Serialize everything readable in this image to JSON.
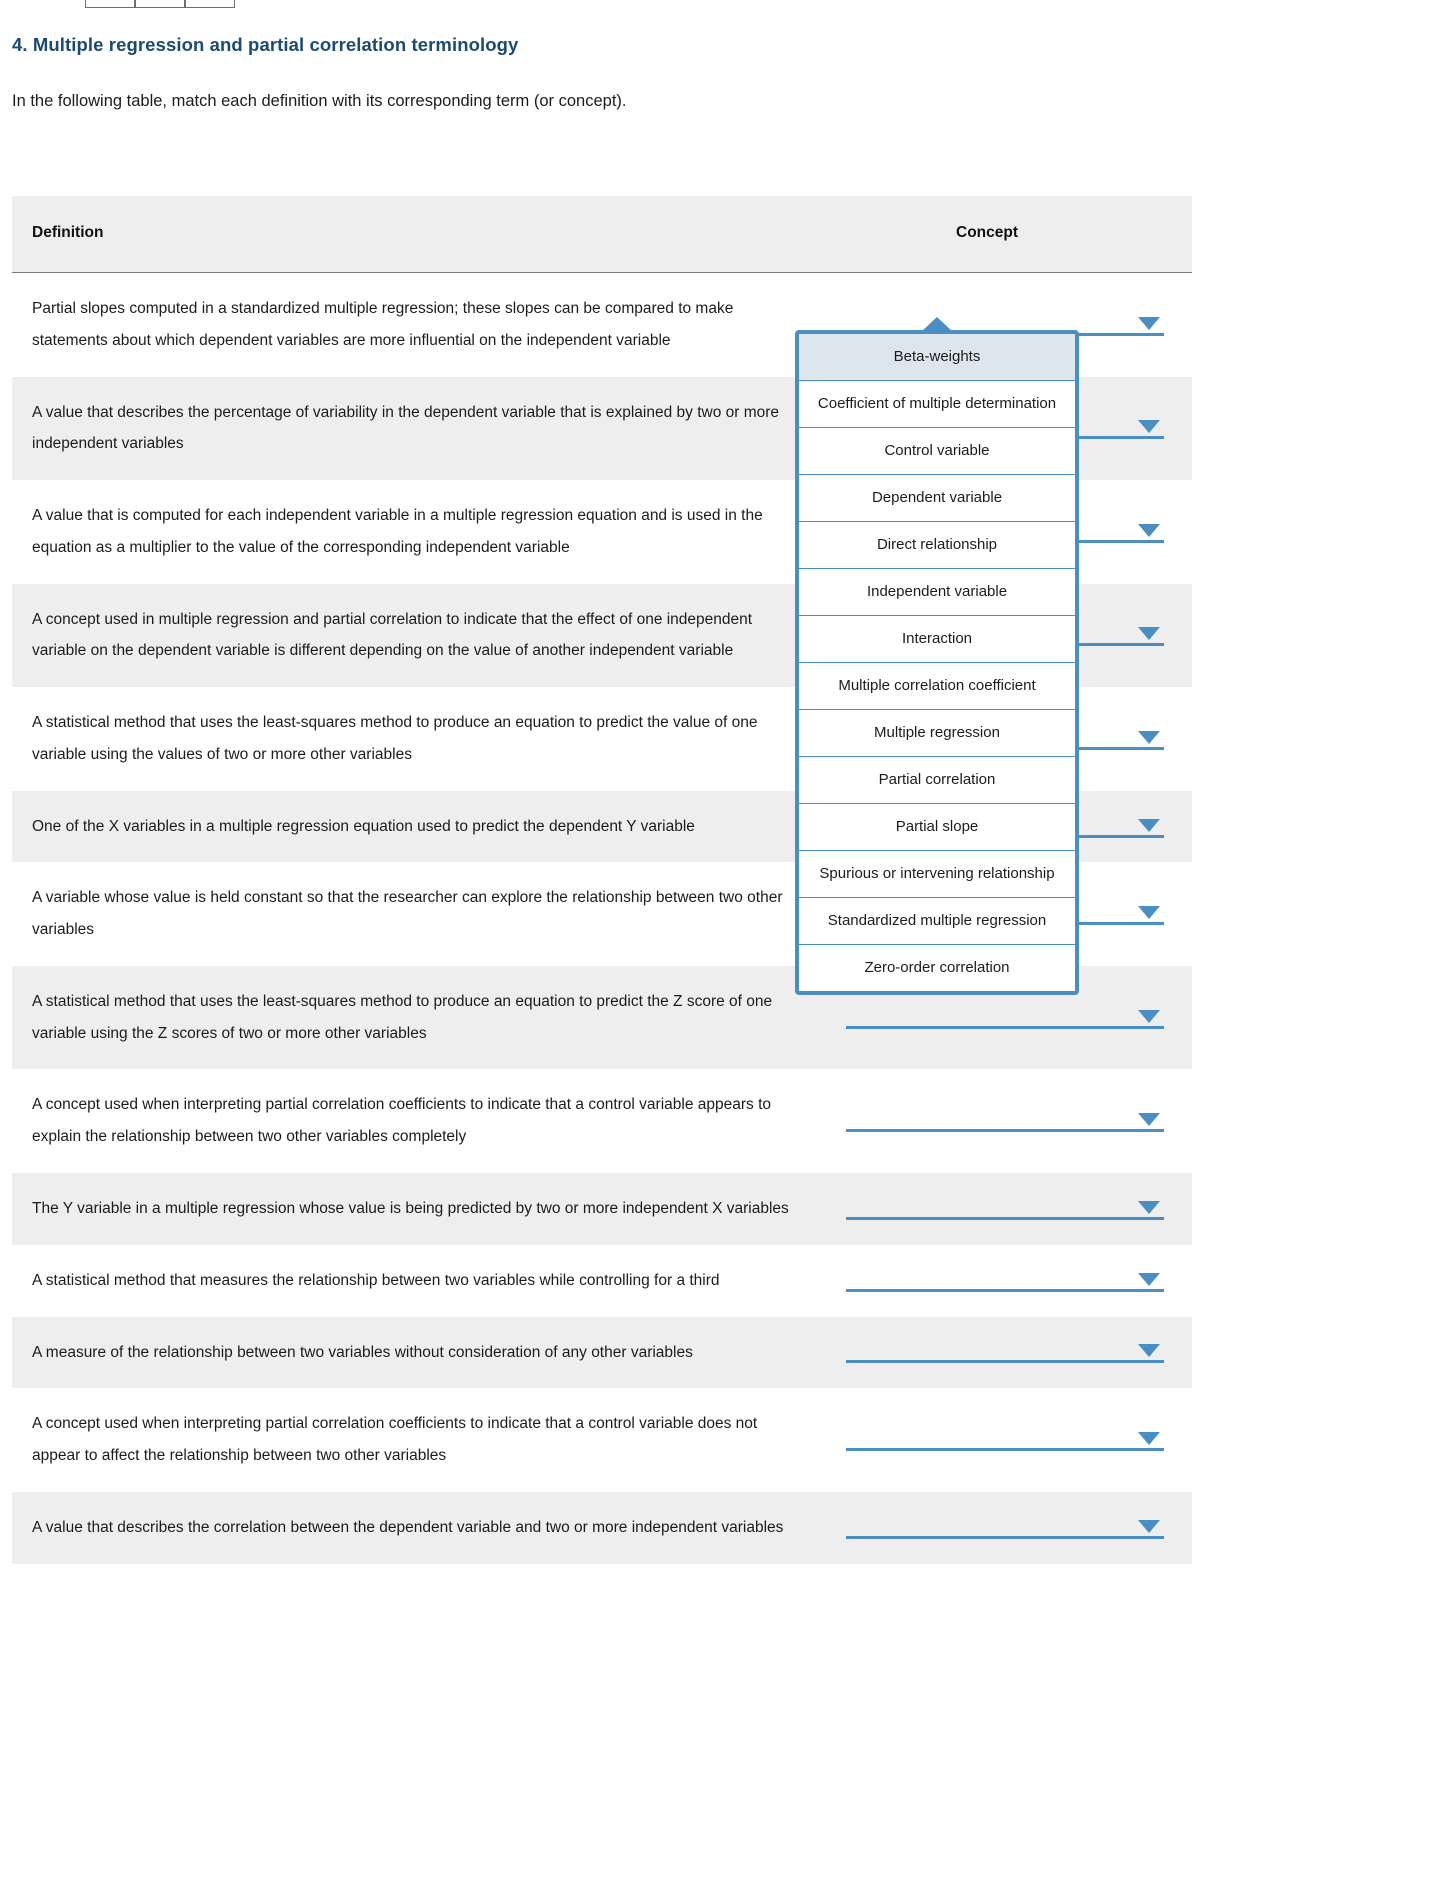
{
  "heading": "4. Multiple regression and partial correlation terminology",
  "intro": "In the following table, match each definition with its corresponding term (or concept).",
  "table": {
    "headers": {
      "definition": "Definition",
      "concept": "Concept"
    },
    "rows": [
      {
        "definition": "Partial slopes computed in a standardized multiple regression; these slopes can be compared to make statements about which dependent variables are more influential on the independent variable",
        "selected": ""
      },
      {
        "definition": "A value that describes the percentage of variability in the dependent variable that is explained by two or more independent variables",
        "selected": ""
      },
      {
        "definition": "A value that is computed for each independent variable in a multiple regression equation and is used in the equation as a multiplier to the value of the corresponding independent variable",
        "selected": ""
      },
      {
        "definition": "A concept used in multiple regression and partial correlation to indicate that the effect of one independent variable on the dependent variable is different depending on the value of another independent variable",
        "selected": ""
      },
      {
        "definition": "A statistical method that uses the least-squares method to produce an equation to predict the value of one variable using the values of two or more other variables",
        "selected": ""
      },
      {
        "definition": "One of the X variables in a multiple regression equation used to predict the dependent Y variable",
        "selected": ""
      },
      {
        "definition": "A variable whose value is held constant so that the researcher can explore the relationship between two other variables",
        "selected": ""
      },
      {
        "definition": "A statistical method that uses the least-squares method to produce an equation to predict the Z score of one variable using the Z scores of two or more other variables",
        "selected": ""
      },
      {
        "definition": "A concept used when interpreting partial correlation coefficients to indicate that a control variable appears to explain the relationship between two other variables completely",
        "selected": ""
      },
      {
        "definition": "The Y variable in a multiple regression whose value is being predicted by two or more independent X variables",
        "selected": ""
      },
      {
        "definition": "A statistical method that measures the relationship between two variables while controlling for a third",
        "selected": ""
      },
      {
        "definition": "A measure of the relationship between two variables without consideration of any other variables",
        "selected": ""
      },
      {
        "definition": "A concept used when interpreting partial correlation coefficients to indicate that a control variable does not appear to affect the relationship between two other variables",
        "selected": ""
      },
      {
        "definition": "A value that describes the correlation between the dependent variable and two or more independent variables",
        "selected": ""
      }
    ]
  },
  "dropdown": {
    "open_for_row": 0,
    "highlighted_index": 0,
    "options": [
      "Beta-weights",
      "Coefficient of multiple determination",
      "Control variable",
      "Dependent variable",
      "Direct relationship",
      "Independent variable",
      "Interaction",
      "Multiple correlation coefficient",
      "Multiple regression",
      "Partial correlation",
      "Partial slope",
      "Spurious or intervening relationship",
      "Standardized multiple regression",
      "Zero-order correlation"
    ]
  },
  "colors": {
    "heading": "#1b4a72",
    "accent": "#4a8ec2",
    "row_alt": "#eeeeee",
    "option_selected": "#dde6ec"
  }
}
